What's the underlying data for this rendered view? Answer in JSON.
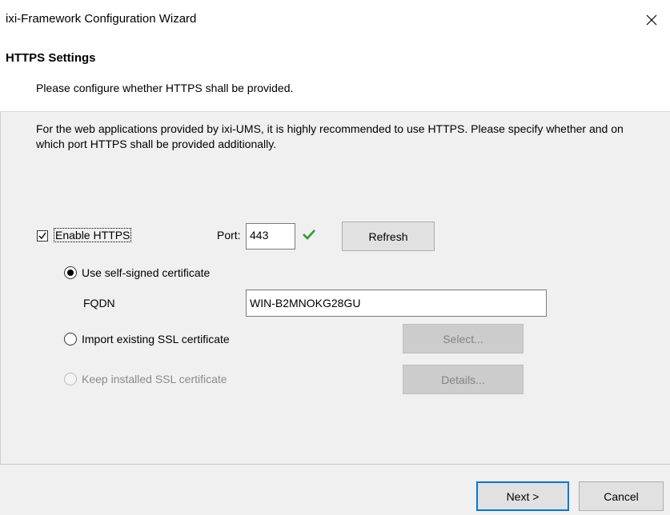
{
  "window": {
    "title": "ixi-Framework Configuration Wizard",
    "close_icon": "close-icon"
  },
  "header": {
    "title": "HTTPS Settings",
    "subtitle": "Please configure whether HTTPS shall be provided."
  },
  "intro_text": "For the web applications provided by ixi-UMS, it is highly recommended to use HTTPS. Please specify whether and on which port HTTPS shall be provided additionally.",
  "https": {
    "enable_label": "Enable HTTPS",
    "enabled": true,
    "port_label": "Port:",
    "port_value": "443",
    "port_valid_icon": "checkmark-icon",
    "refresh_label": "Refresh"
  },
  "certificate": {
    "options": [
      {
        "label": "Use self-signed certificate",
        "selected": true,
        "enabled": true
      },
      {
        "label": "Import existing SSL certificate",
        "selected": false,
        "enabled": true
      },
      {
        "label": "Keep installed SSL certificate",
        "selected": false,
        "enabled": false
      }
    ],
    "fqdn_label": "FQDN",
    "fqdn_value": "WIN-B2MNOKG28GU",
    "select_label": "Select...",
    "details_label": "Details..."
  },
  "footer": {
    "next_label": "Next >",
    "cancel_label": "Cancel"
  },
  "colors": {
    "accent": "#0078d7",
    "valid_check": "#2e9d2e"
  }
}
